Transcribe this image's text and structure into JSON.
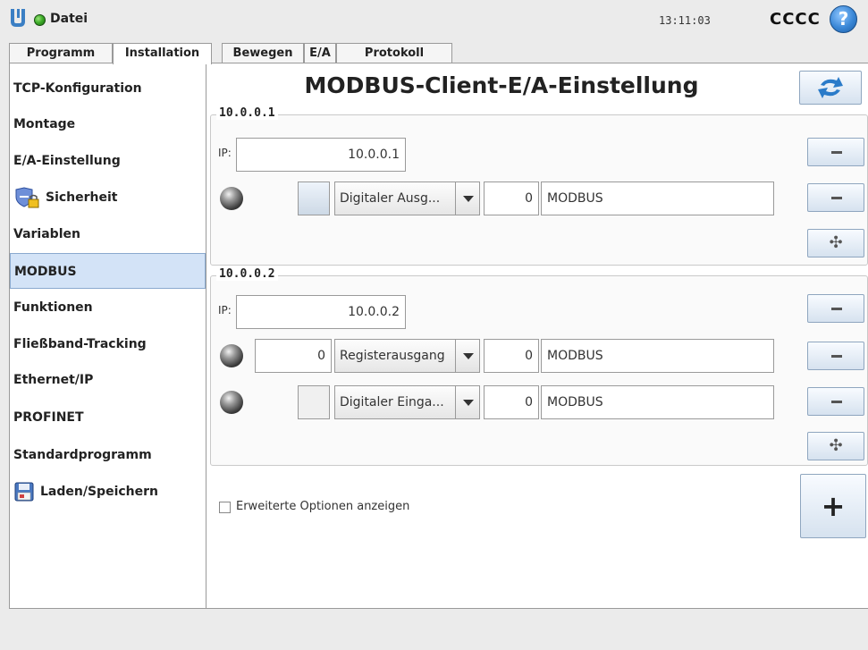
{
  "header": {
    "file_name": "Datei",
    "time": "13:11:03",
    "robot_name": "CCCC",
    "help_glyph": "?",
    "status_color": "#3fae2a"
  },
  "tabs": [
    {
      "label": "Programm",
      "active": false
    },
    {
      "label": "Installation",
      "active": true
    },
    {
      "label": "Bewegen",
      "active": false
    },
    {
      "label": "E/A",
      "active": false
    },
    {
      "label": "Protokoll",
      "active": false
    }
  ],
  "sidebar": {
    "items": [
      {
        "label": "TCP-Konfiguration"
      },
      {
        "label": "Montage"
      },
      {
        "label": "E/A-Einstellung"
      },
      {
        "label": "Sicherheit",
        "icon": "shield-lock-icon"
      },
      {
        "label": "Variablen"
      },
      {
        "label": "MODBUS",
        "selected": true
      },
      {
        "label": "Funktionen"
      },
      {
        "label": "Fließband-Tracking"
      },
      {
        "label": "Ethernet/IP"
      },
      {
        "label": "PROFINET"
      },
      {
        "label": "Standardprogramm"
      },
      {
        "label": "Laden/Speichern",
        "icon": "floppy-disk-icon"
      }
    ]
  },
  "main": {
    "title": "MODBUS-Client-E/A-Einstellung",
    "ip_label": "IP:",
    "units": [
      {
        "name": "10.0.0.1",
        "ip": "10.0.0.1",
        "signals": [
          {
            "value": "",
            "type": "Digitaler Ausg...",
            "address": "0",
            "name": "MODBUS"
          }
        ]
      },
      {
        "name": "10.0.0.2",
        "ip": "10.0.0.2",
        "signals": [
          {
            "value": "0",
            "type": "Registerausgang",
            "address": "0",
            "name": "MODBUS"
          },
          {
            "value": "",
            "type": "Digitaler Einga...",
            "address": "0",
            "name": "MODBUS"
          }
        ]
      }
    ],
    "advanced_label": "Erweiterte Optionen anzeigen",
    "add_unit_glyph": "+",
    "add_signal_glyph": "✣"
  }
}
